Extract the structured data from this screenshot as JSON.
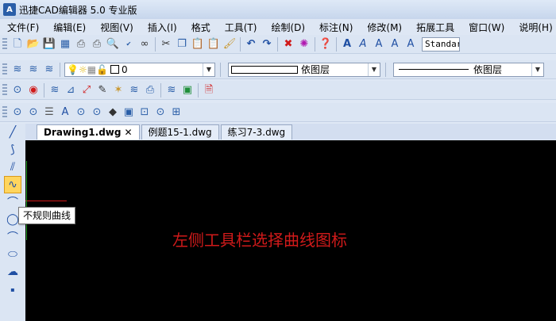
{
  "window": {
    "title": "迅捷CAD编辑器 5.0 专业版",
    "logo_text": "A"
  },
  "menubar": [
    "文件(F)",
    "编辑(E)",
    "视图(V)",
    "插入(I)",
    "格式",
    "工具(T)",
    "绘制(D)",
    "标注(N)",
    "修改(M)",
    "拓展工具",
    "窗口(W)",
    "说明(H)"
  ],
  "toolbar1": {
    "icons": [
      "new-file-icon",
      "open-icon",
      "save-icon",
      "print-preview-icon",
      "print-icon",
      "plot-icon",
      "find-icon",
      "spell-check-icon",
      "binoculars-icon",
      "cut-icon",
      "copy-icon",
      "paste-icon",
      "paste-special-icon",
      "match-properties-icon",
      "undo-icon",
      "redo-icon",
      "erase-icon",
      "purge-icon",
      "help-icon",
      "text-style-icon",
      "text-icon",
      "text-edit-icon",
      "text-find-icon",
      "text-scale-icon"
    ],
    "text_style": "Standard"
  },
  "toolbar2": {
    "layer_value": "0",
    "linetype_value": "依图层",
    "lineweight_value": "依图层"
  },
  "tabs": [
    {
      "label": "Drawing1.dwg",
      "close": "✕"
    },
    {
      "label": "例题15-1.dwg"
    },
    {
      "label": "练习7-3.dwg"
    }
  ],
  "left_toolbar": {
    "icons": [
      "line-icon",
      "polyline-icon",
      "multiline-icon",
      "spline-icon",
      "arc-icon",
      "circle-icon",
      "arc-3pt-icon",
      "ellipse-icon",
      "revision-cloud-icon",
      "point-icon"
    ]
  },
  "tooltip": "不规则曲线",
  "canvas": {
    "hint": "左侧工具栏选择曲线图标"
  },
  "colors": {
    "canvas": "#000000",
    "hint": "#d01a1a",
    "active_tool": "#ffd55e"
  }
}
